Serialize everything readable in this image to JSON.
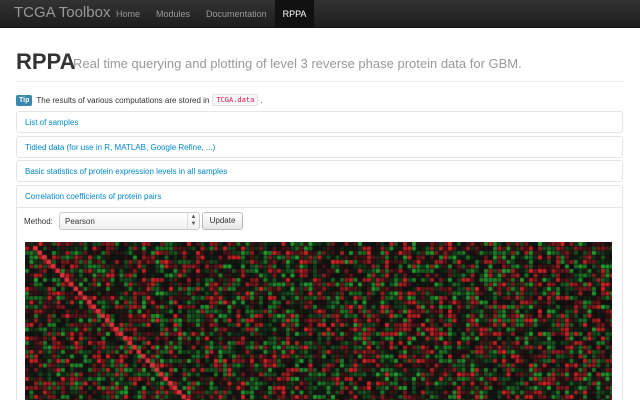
{
  "navbar": {
    "brand": "TCGA Toolbox",
    "items": [
      {
        "label": "Home",
        "active": false
      },
      {
        "label": "Modules",
        "active": false
      },
      {
        "label": "Documentation",
        "active": false
      },
      {
        "label": "RPPA",
        "active": true
      }
    ]
  },
  "header": {
    "title": "RPPA",
    "subtitle": "Real time querying and plotting of level 3 reverse phase protein data for GBM."
  },
  "tip": {
    "badge": "Tip",
    "text": "The results of various computations are stored in",
    "code": "TCGA.data",
    "period": "."
  },
  "sections": [
    {
      "label": "List of samples"
    },
    {
      "label": "Tidied data (for use in R, MATLAB, Google Refine, ...)"
    },
    {
      "label": "Basic statistics of protein expression levels in all samples"
    },
    {
      "label": "Correlation coefficients of protein pairs"
    }
  ],
  "correlation": {
    "method_label": "Method:",
    "method_value": "Pearson",
    "update_label": "Update"
  },
  "colors": {
    "positive": "#e0303a",
    "negative": "#27a33a",
    "background": "#0b0b0b",
    "link": "#0088cc",
    "tip_badge": "#3a87ad"
  }
}
